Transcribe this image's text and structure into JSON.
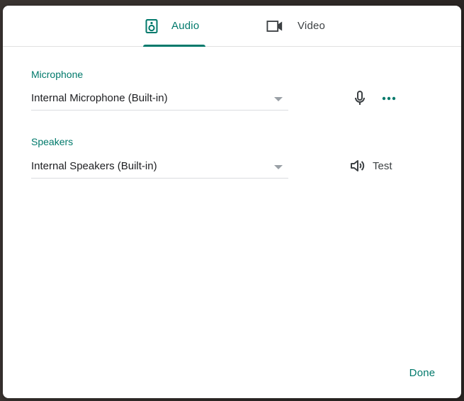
{
  "tabs": [
    {
      "label": "Audio",
      "icon": "speaker-icon",
      "active": true
    },
    {
      "label": "Video",
      "icon": "videocam-icon",
      "active": false
    }
  ],
  "microphone": {
    "label": "Microphone",
    "selected": "Internal Microphone (Built-in)"
  },
  "speakers": {
    "label": "Speakers",
    "selected": "Internal Speakers (Built-in)",
    "test_label": "Test"
  },
  "footer": {
    "done_label": "Done"
  },
  "colors": {
    "accent": "#00796b",
    "text": "#202124",
    "muted": "#9aa0a6"
  }
}
